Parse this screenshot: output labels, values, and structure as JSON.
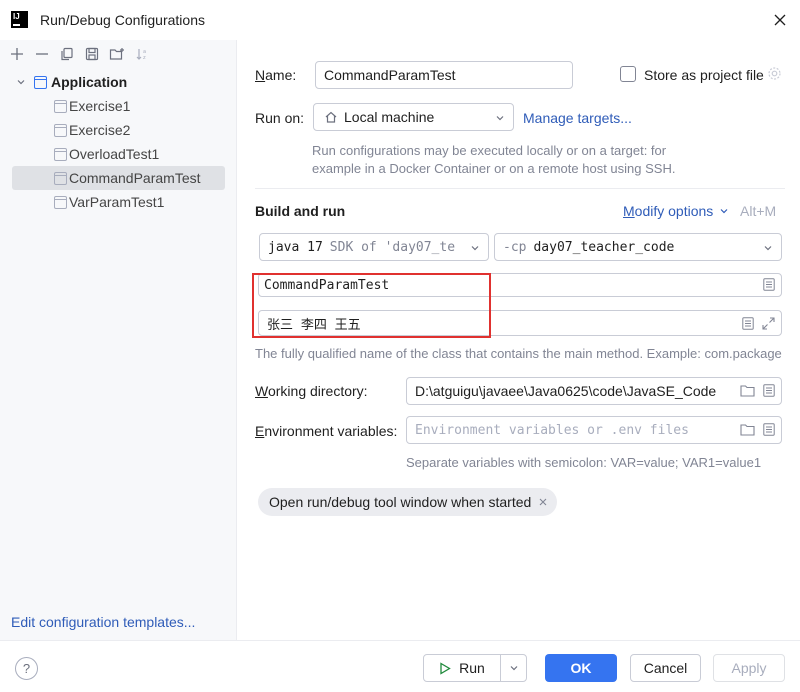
{
  "window": {
    "title": "Run/Debug Configurations",
    "app_icon_text": "IJ"
  },
  "sidebar": {
    "root": {
      "label": "Application",
      "expanded": true
    },
    "items": [
      {
        "label": "Exercise1",
        "selected": false
      },
      {
        "label": "Exercise2",
        "selected": false
      },
      {
        "label": "OverloadTest1",
        "selected": false
      },
      {
        "label": "CommandParamTest",
        "selected": true
      },
      {
        "label": "VarParamTest1",
        "selected": false
      }
    ],
    "edit_templates_link": "Edit configuration templates..."
  },
  "toolbar_icons": [
    "add-icon",
    "remove-icon",
    "copy-icon",
    "save-icon",
    "new-folder-icon",
    "sort-icon"
  ],
  "form": {
    "name_label": "Name:",
    "name_value": "CommandParamTest",
    "store_label": "Store as project file",
    "store_checked": false,
    "run_on_label": "Run on:",
    "run_on_value": "Local machine",
    "manage_targets": "Manage targets...",
    "run_on_hint_line1": "Run configurations may be executed locally or on a target: for",
    "run_on_hint_line2": "example in a Docker Container or on a remote host using SSH.",
    "build_and_run_title": "Build and run",
    "modify_options": "Modify options",
    "modify_shortcut": "Alt+M",
    "jdk_version": "java 17",
    "jdk_detail": "SDK of 'day07_te",
    "cp_prefix": "-cp",
    "cp_value": "day07_teacher_code",
    "main_class_value": "CommandParamTest",
    "program_args_value": "张三 李四 王五",
    "main_class_hint": "The fully qualified name of the class that contains the main method. Example: com.package",
    "working_dir_label": "Working directory:",
    "working_dir_value": "D:\\atguigu\\javaee\\Java0625\\code\\JavaSE_Code",
    "env_label": "Environment variables:",
    "env_placeholder": "Environment variables or .env files",
    "env_hint": "Separate variables with semicolon: VAR=value; VAR1=value1",
    "chip_label": "Open run/debug tool window when started"
  },
  "footer": {
    "help": "?",
    "run": "Run",
    "ok": "OK",
    "cancel": "Cancel",
    "apply": "Apply"
  },
  "colors": {
    "accent": "#3574f0",
    "link": "#2f5cb8",
    "highlight_box": "#e0312f",
    "selection": "#dfe1e5"
  }
}
